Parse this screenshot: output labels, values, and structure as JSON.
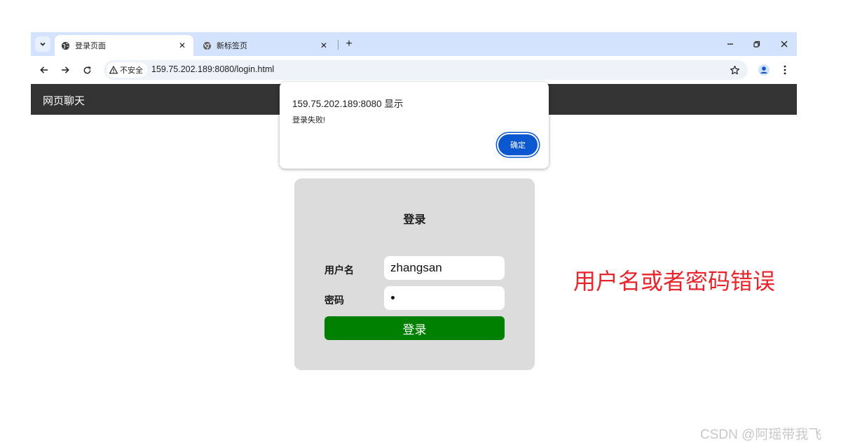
{
  "browser": {
    "tabs": [
      {
        "title": "登录页面",
        "active": true,
        "favicon": "globe-icon"
      },
      {
        "title": "新标签页",
        "active": false,
        "favicon": "chrome-icon"
      }
    ],
    "security_label": "不安全",
    "url": "159.75.202.189:8080/login.html"
  },
  "site": {
    "brand": "网页聊天"
  },
  "dialog": {
    "title": "159.75.202.189:8080 显示",
    "message": "登录失败!",
    "ok_label": "确定",
    "accent": "#0b57d0"
  },
  "login": {
    "title": "登录",
    "username_label": "用户名",
    "username_value": "zhangsan",
    "password_label": "密码",
    "submit_label": "登录",
    "submit_color": "#008000"
  },
  "annotation": {
    "text": "用户名或者密码错误",
    "color": "#e8252c"
  },
  "watermark": "CSDN @阿瑶带我飞"
}
